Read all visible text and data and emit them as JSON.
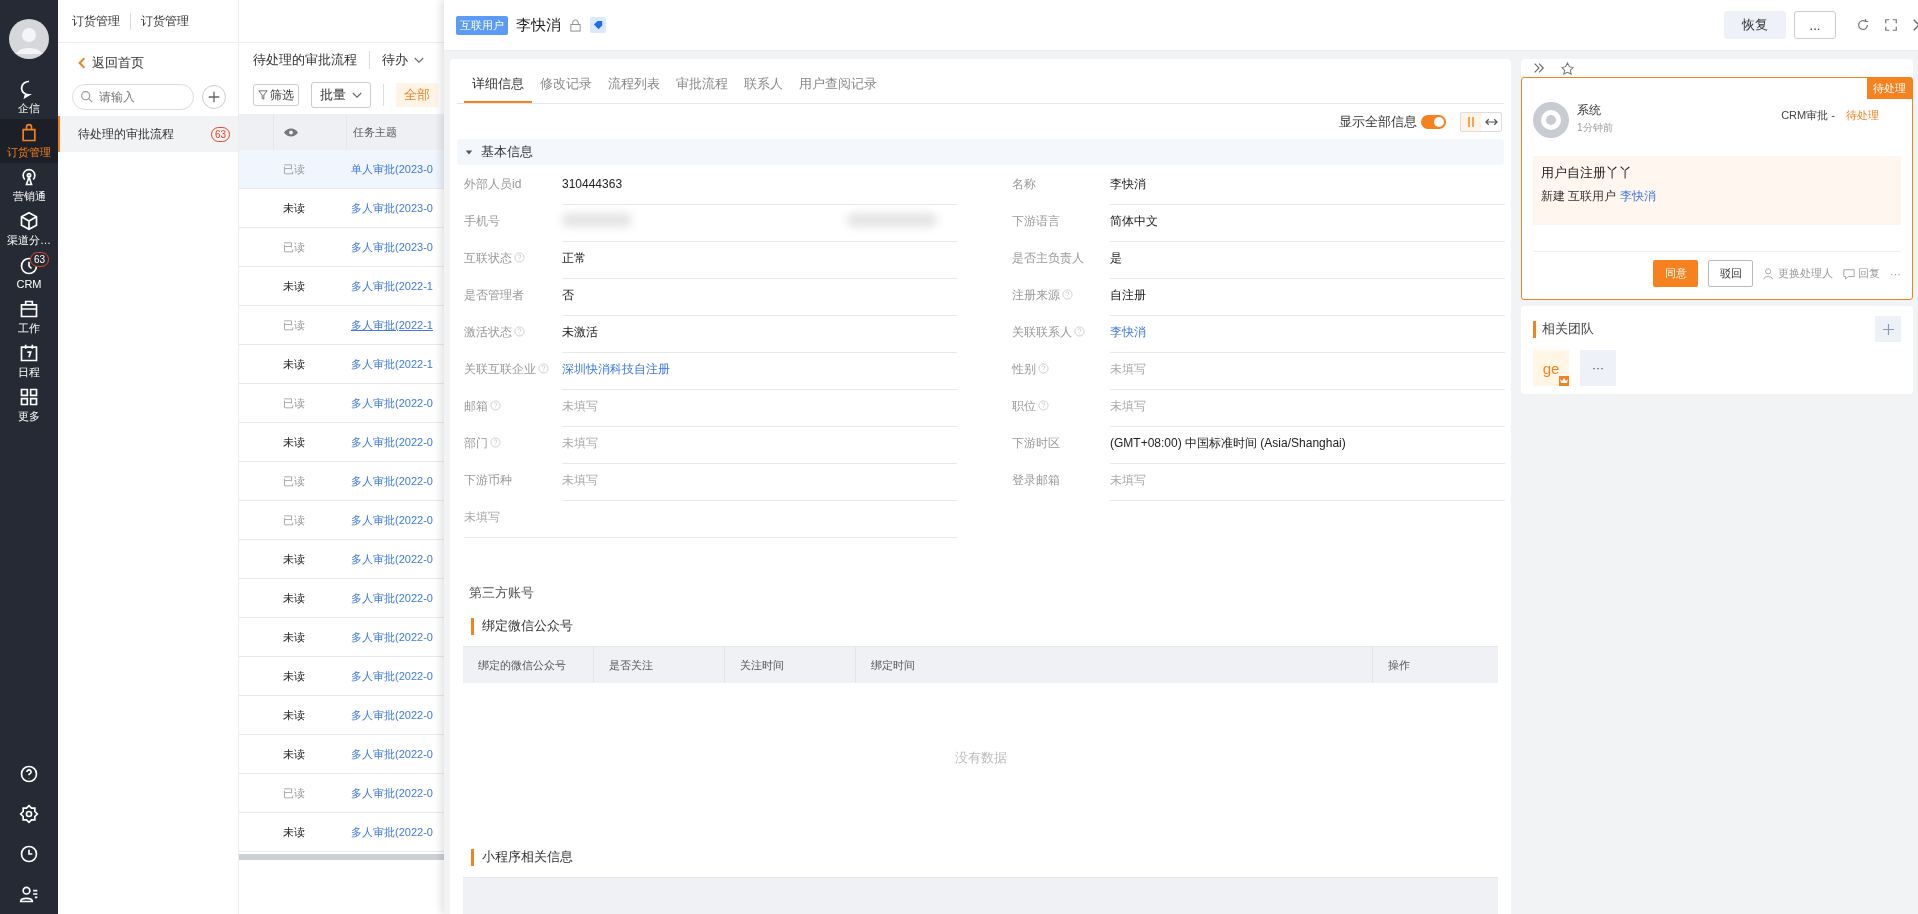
{
  "nav": [
    {
      "label": "企信",
      "selected": false
    },
    {
      "label": "订货管理",
      "selected": true
    },
    {
      "label": "营销通",
      "selected": false
    },
    {
      "label": "渠道分…",
      "selected": false
    },
    {
      "label": "CRM",
      "selected": false,
      "badge": "63"
    },
    {
      "label": "工作",
      "selected": false
    },
    {
      "label": "日程",
      "selected": false
    },
    {
      "label": "更多",
      "selected": false
    }
  ],
  "breadcrumb": [
    "订货管理",
    "订货管理"
  ],
  "back_link": "返回首页",
  "search": {
    "placeholder": "请输入"
  },
  "subnav_items": [
    {
      "label": "待处理的审批流程",
      "count": "63",
      "selected": true
    }
  ],
  "list": {
    "title": "待处理的审批流程",
    "view": "待办",
    "filter": "筛选",
    "batch": "批量",
    "scope": "全部",
    "subject_column": "任务主题",
    "rows": [
      {
        "read_status": "已读",
        "read": true,
        "subject": "单人审批(2023-0",
        "selected": true,
        "hovered": false
      },
      {
        "read_status": "未读",
        "read": false,
        "subject": "多人审批(2023-0",
        "selected": false,
        "hovered": false
      },
      {
        "read_status": "已读",
        "read": true,
        "subject": "多人审批(2023-0",
        "selected": false,
        "hovered": false
      },
      {
        "read_status": "未读",
        "read": false,
        "subject": "多人审批(2022-1",
        "selected": false,
        "hovered": false
      },
      {
        "read_status": "已读",
        "read": true,
        "subject": "多人审批(2022-1",
        "selected": false,
        "hovered": true
      },
      {
        "read_status": "未读",
        "read": false,
        "subject": "多人审批(2022-1",
        "selected": false,
        "hovered": false
      },
      {
        "read_status": "已读",
        "read": true,
        "subject": "多人审批(2022-0",
        "selected": false,
        "hovered": false
      },
      {
        "read_status": "未读",
        "read": false,
        "subject": "多人审批(2022-0",
        "selected": false,
        "hovered": false
      },
      {
        "read_status": "已读",
        "read": true,
        "subject": "多人审批(2022-0",
        "selected": false,
        "hovered": false
      },
      {
        "read_status": "已读",
        "read": true,
        "subject": "多人审批(2022-0",
        "selected": false,
        "hovered": false
      },
      {
        "read_status": "未读",
        "read": false,
        "subject": "多人审批(2022-0",
        "selected": false,
        "hovered": false
      },
      {
        "read_status": "未读",
        "read": false,
        "subject": "多人审批(2022-0",
        "selected": false,
        "hovered": false
      },
      {
        "read_status": "未读",
        "read": false,
        "subject": "多人审批(2022-0",
        "selected": false,
        "hovered": false
      },
      {
        "read_status": "未读",
        "read": false,
        "subject": "多人审批(2022-0",
        "selected": false,
        "hovered": false
      },
      {
        "read_status": "未读",
        "read": false,
        "subject": "多人审批(2022-0",
        "selected": false,
        "hovered": false
      },
      {
        "read_status": "未读",
        "read": false,
        "subject": "多人审批(2022-0",
        "selected": false,
        "hovered": false
      },
      {
        "read_status": "已读",
        "read": true,
        "subject": "多人审批(2022-0",
        "selected": false,
        "hovered": false
      },
      {
        "read_status": "未读",
        "read": false,
        "subject": "多人审批(2022-0",
        "selected": false,
        "hovered": false
      }
    ]
  },
  "drawer": {
    "tag": "互联用户",
    "title": "李快消",
    "restore": "恢复",
    "more": "..."
  },
  "tabs": [
    {
      "label": "详细信息",
      "selected": true
    },
    {
      "label": "修改记录",
      "selected": false
    },
    {
      "label": "流程列表",
      "selected": false
    },
    {
      "label": "审批流程",
      "selected": false
    },
    {
      "label": "联系人",
      "selected": false
    },
    {
      "label": "用户查阅记录",
      "selected": false
    }
  ],
  "show_all": {
    "label": "显示全部信息",
    "on": true
  },
  "layout_modes": [
    {
      "kind": "columns",
      "selected": true
    },
    {
      "kind": "stretch",
      "selected": false
    }
  ],
  "section": {
    "title": "基本信息",
    "expanded": true,
    "rows": [
      {
        "left": {
          "label": "外部人员id",
          "help": false,
          "kind": "text",
          "value": "310444363"
        },
        "right": {
          "label": "名称",
          "help": false,
          "kind": "text",
          "value": "李快消"
        }
      },
      {
        "left": {
          "label": "手机号",
          "help": false,
          "kind": "blurred"
        },
        "right": {
          "label": "下游语言",
          "help": false,
          "kind": "text",
          "value": "简体中文"
        }
      },
      {
        "left": {
          "label": "互联状态",
          "help": true,
          "kind": "text",
          "value": "正常"
        },
        "right": {
          "label": "是否主负责人",
          "help": false,
          "kind": "text",
          "value": "是"
        }
      },
      {
        "left": {
          "label": "是否管理者",
          "help": false,
          "kind": "text",
          "value": "否"
        },
        "right": {
          "label": "注册来源",
          "help": true,
          "kind": "text",
          "value": "自注册"
        }
      },
      {
        "left": {
          "label": "激活状态",
          "help": true,
          "kind": "text",
          "value": "未激活"
        },
        "right": {
          "label": "关联联系人",
          "help": true,
          "kind": "link",
          "value": "李快消"
        }
      },
      {
        "left": {
          "label": "关联互联企业",
          "help": true,
          "kind": "link",
          "value": "深圳快消科技自注册"
        },
        "right": {
          "label": "性别",
          "help": true,
          "kind": "empty",
          "value": "未填写"
        }
      },
      {
        "left": {
          "label": "邮箱",
          "help": true,
          "kind": "empty",
          "value": "未填写"
        },
        "right": {
          "label": "职位",
          "help": true,
          "kind": "empty",
          "value": "未填写"
        }
      },
      {
        "left": {
          "label": "部门",
          "help": true,
          "kind": "empty",
          "value": "未填写"
        },
        "right": {
          "label": "下游时区",
          "help": false,
          "kind": "text",
          "value": "(GMT+08:00) 中国标准时间 (Asia/Shanghai)"
        }
      },
      {
        "left": {
          "label": "下游币种",
          "help": false,
          "kind": "empty",
          "value": "未填写"
        },
        "right": {
          "label": "登录邮箱",
          "help": false,
          "kind": "empty",
          "value": "未填写"
        }
      },
      {
        "left": {
          "label": "未填写",
          "help": false,
          "kind": "none"
        }
      }
    ]
  },
  "third_party": {
    "title": "第三方账号",
    "groups": [
      {
        "title": "绑定微信公众号",
        "columns": [
          "绑定的微信公众号",
          "是否关注",
          "关注时间",
          "绑定时间",
          "操作"
        ],
        "empty_text": "没有数据"
      },
      {
        "title": "小程序相关信息"
      }
    ]
  },
  "todo": {
    "badge": "待处理",
    "sender": "系统",
    "time": "1分钟前",
    "source": "CRM审批 - ",
    "status": "待处理",
    "message_title": "用户自注册丫丫",
    "message": "新建 互联用户 ",
    "message_link": "李快消",
    "approve": "同意",
    "reject": "驳回",
    "reassign": "更换处理人",
    "reply": "回复",
    "more": "···"
  },
  "team": {
    "title": "相关团队",
    "members": [
      {
        "initials": "ge",
        "owner": true
      }
    ],
    "more": "···"
  }
}
